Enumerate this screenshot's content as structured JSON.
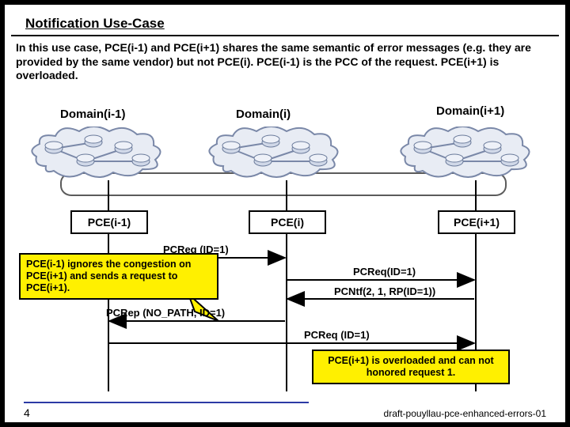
{
  "title": "Notification Use-Case",
  "body": "In this use case, PCE(i-1) and PCE(i+1) shares the same semantic of error messages (e.g. they are provided by the same vendor) but not PCE(i). PCE(i-1) is the PCC of the request. PCE(i+1) is overloaded.",
  "domains": {
    "left": "Domain(i-1)",
    "center": "Domain(i)",
    "right": "Domain(i+1)"
  },
  "pce": {
    "left": "PCE(i-1)",
    "center": "PCE(i)",
    "right": "PCE(i+1)"
  },
  "messages": {
    "req1": "PCReq (ID=1)",
    "req2": "PCReq(ID=1)",
    "ntf": "PCNtf(2, 1, RP(ID=1))",
    "rep": "PCRep (NO_PATH, ID=1)",
    "req3": "PCReq (ID=1)"
  },
  "callouts": {
    "ignore": "PCE(i-1) ignores the congestion on PCE(i+1) and sends a request to PCE(i+1).",
    "overload": "PCE(i+1) is overloaded and can not honored request 1."
  },
  "footer": {
    "page": "4",
    "draft": "draft-pouyllau-pce-enhanced-errors-01"
  }
}
